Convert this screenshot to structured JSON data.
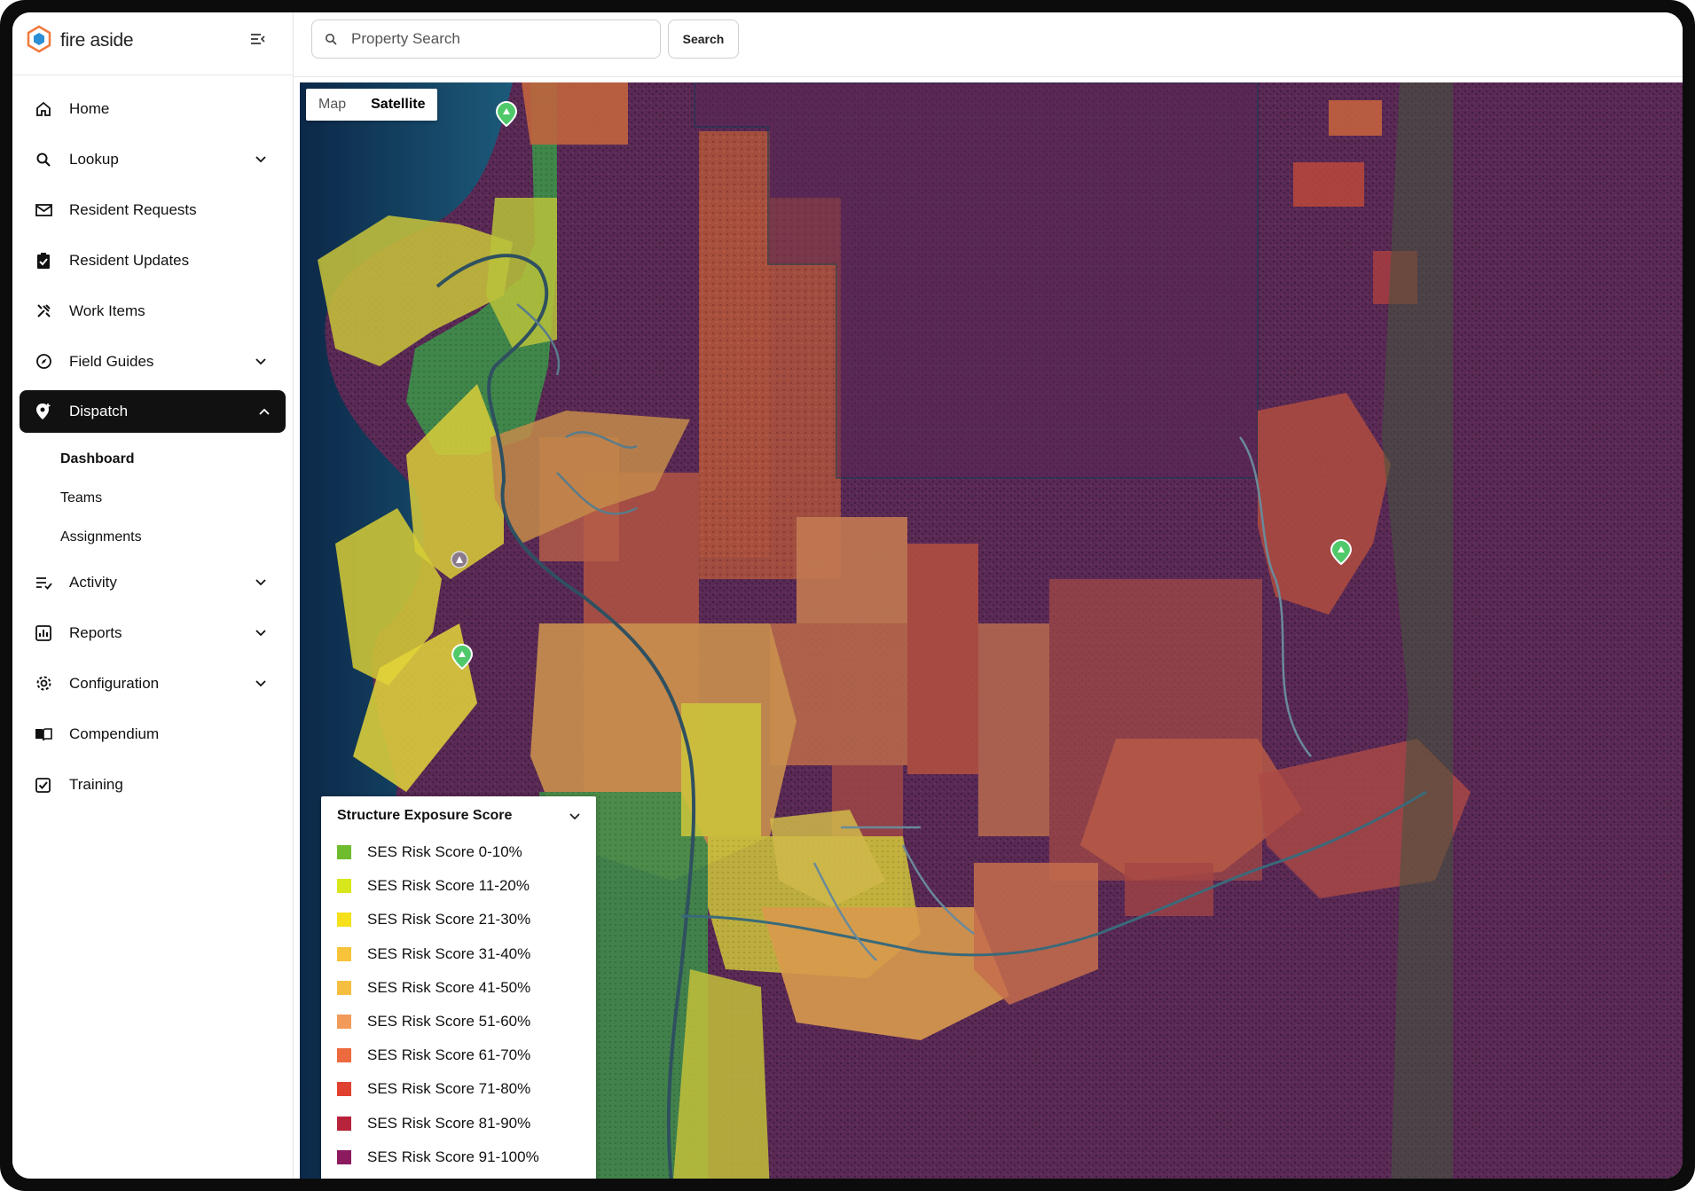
{
  "brand": {
    "name": "fire aside",
    "logo_icon": "hexagon-logo-icon",
    "accent": "#2b8fd6",
    "logo_outline": "#f07a3c"
  },
  "nav": {
    "items": [
      {
        "label": "Home",
        "icon": "home-icon",
        "expandable": false
      },
      {
        "label": "Lookup",
        "icon": "search-icon",
        "expandable": true
      },
      {
        "label": "Resident Requests",
        "icon": "mail-icon",
        "expandable": false
      },
      {
        "label": "Resident Updates",
        "icon": "clipboard-check-icon",
        "expandable": false
      },
      {
        "label": "Work Items",
        "icon": "tools-icon",
        "expandable": false
      },
      {
        "label": "Field Guides",
        "icon": "compass-icon",
        "expandable": true
      },
      {
        "label": "Dispatch",
        "icon": "location-pin-icon",
        "expandable": true,
        "active": true
      },
      {
        "label": "Activity",
        "icon": "list-icon",
        "expandable": true
      },
      {
        "label": "Reports",
        "icon": "chart-icon",
        "expandable": true
      },
      {
        "label": "Configuration",
        "icon": "gear-icon",
        "expandable": true
      },
      {
        "label": "Compendium",
        "icon": "book-icon",
        "expandable": false
      },
      {
        "label": "Training",
        "icon": "checkbox-icon",
        "expandable": false
      }
    ],
    "dispatch_sub": [
      "Dashboard",
      "Teams",
      "Assignments"
    ],
    "dispatch_current": "Dashboard"
  },
  "search": {
    "placeholder": "Property Search",
    "button_label": "Search"
  },
  "map": {
    "type_options": [
      "Map",
      "Satellite"
    ],
    "selected_type": "Satellite"
  },
  "legend": {
    "title": "Structure Exposure Score",
    "items": [
      {
        "label": "SES Risk Score 0-10%",
        "color": "#6fbd2e"
      },
      {
        "label": "SES Risk Score 11-20%",
        "color": "#d8e61c"
      },
      {
        "label": "SES Risk Score 21-30%",
        "color": "#f5e01a"
      },
      {
        "label": "SES Risk Score 31-40%",
        "color": "#f6c33a"
      },
      {
        "label": "SES Risk Score 41-50%",
        "color": "#f4bf40"
      },
      {
        "label": "SES Risk Score 51-60%",
        "color": "#f29a5a"
      },
      {
        "label": "SES Risk Score 61-70%",
        "color": "#ec6a3e"
      },
      {
        "label": "SES Risk Score 71-80%",
        "color": "#e0402f"
      },
      {
        "label": "SES Risk Score 81-90%",
        "color": "#b8233c"
      },
      {
        "label": "SES Risk Score 91-100%",
        "color": "#8b1a5e"
      }
    ]
  }
}
